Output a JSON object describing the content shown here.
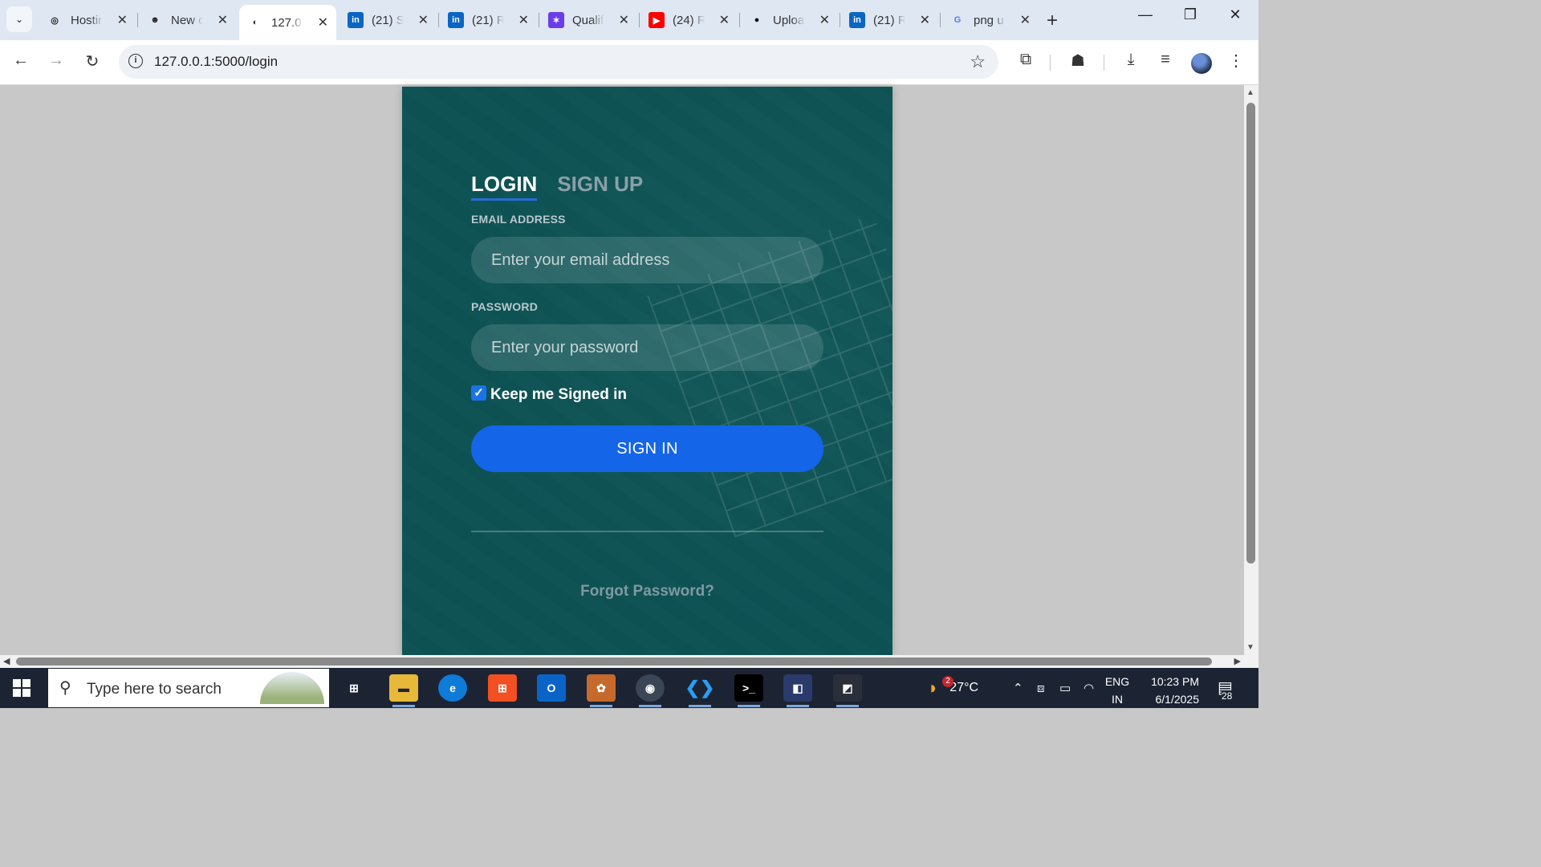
{
  "browser": {
    "tabs": [
      {
        "title": "Hostir",
        "icon": "openai-icon",
        "glyph": "◎",
        "bg": "transparent",
        "fg": "#222"
      },
      {
        "title": "New c",
        "icon": "copilot-icon",
        "glyph": "☻",
        "bg": "transparent",
        "fg": "#222"
      },
      {
        "title": "127.0.",
        "icon": "globe-icon",
        "glyph": "◐",
        "bg": "transparent",
        "fg": "#333",
        "active": true
      },
      {
        "title": "(21) S",
        "icon": "linkedin-icon",
        "glyph": "in",
        "bg": "#0a66c2",
        "fg": "#fff"
      },
      {
        "title": "(21) R",
        "icon": "linkedin-icon",
        "glyph": "in",
        "bg": "#0a66c2",
        "fg": "#fff"
      },
      {
        "title": "Qualif",
        "icon": "qualifier-icon",
        "glyph": "✶",
        "bg": "#6a3de8",
        "fg": "#fff"
      },
      {
        "title": "(24) R",
        "icon": "youtube-icon",
        "glyph": "▶",
        "bg": "#ff0000",
        "fg": "#fff"
      },
      {
        "title": "Uploa",
        "icon": "github-icon",
        "glyph": "●",
        "bg": "transparent",
        "fg": "#111"
      },
      {
        "title": "(21) R",
        "icon": "linkedin-icon",
        "glyph": "in",
        "bg": "#0a66c2",
        "fg": "#fff"
      },
      {
        "title": "png u",
        "icon": "google-icon",
        "glyph": "G",
        "bg": "transparent",
        "fg": "#4285f4"
      }
    ],
    "url": "127.0.0.1:5000/login"
  },
  "login": {
    "login_tab": "LOGIN",
    "signup_tab": "SIGN UP",
    "email_label": "EMAIL ADDRESS",
    "email_placeholder": "Enter your email address",
    "email_value": "",
    "password_label": "PASSWORD",
    "password_placeholder": "Enter your password",
    "password_value": "",
    "keep_signed_in_label": "Keep me Signed in",
    "keep_signed_in_checked": true,
    "signin_button": "SIGN IN",
    "forgot_password": "Forgot Password?"
  },
  "taskbar": {
    "search_placeholder": "Type here to search",
    "weather_badge": "2",
    "temperature": "27°C",
    "language_top": "ENG",
    "language_bottom": "IN",
    "time": "10:23 PM",
    "date": "6/1/2025",
    "notification_count": "28"
  },
  "colors": {
    "accent": "#1565e8",
    "card_bg": "#0c5254",
    "tabbar_bg": "#dfe7f3",
    "taskbar_bg": "#1c2433"
  }
}
